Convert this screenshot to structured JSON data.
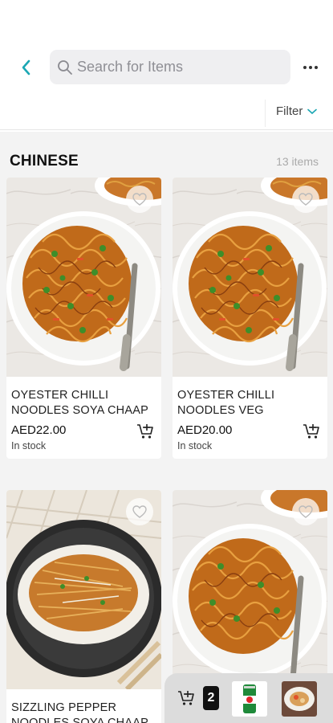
{
  "search": {
    "placeholder": "Search for Items",
    "value": ""
  },
  "filter": {
    "label": "Filter"
  },
  "section": {
    "title": "CHINESE",
    "count": "13 items"
  },
  "products": [
    {
      "name": "OYESTER CHILLI NOODLES SOYA CHAAP",
      "price": "AED22.00",
      "stock": "In stock",
      "image": "hakka-noodles"
    },
    {
      "name": "OYESTER CHILLI NOODLES VEG",
      "price": "AED20.00",
      "stock": "In stock",
      "image": "hakka-noodles"
    },
    {
      "name": "SIZZLING PEPPER NOODLES SOYA CHAAP",
      "price": "",
      "stock": "",
      "image": "crispy-noodles"
    },
    {
      "name": "",
      "price": "",
      "stock": "",
      "image": "hakka-noodles"
    }
  ],
  "cart": {
    "count": "2",
    "items": [
      "7up-can",
      "food-plate"
    ]
  },
  "colors": {
    "accent": "#1ba7b4",
    "background": "#f3f3f3",
    "search_bg": "#efeff1"
  }
}
